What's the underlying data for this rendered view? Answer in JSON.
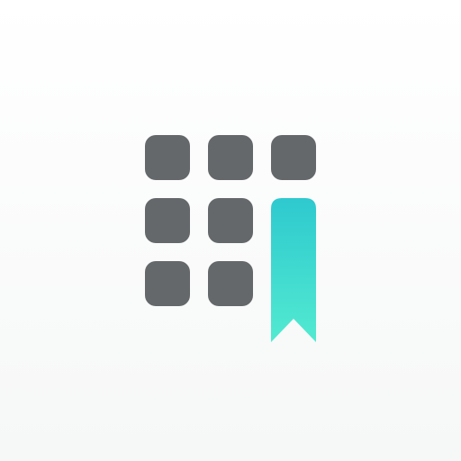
{
  "app_icon": {
    "grid": {
      "rows": 3,
      "cols": 3,
      "tile_color": "#65686b",
      "filled_tiles": [
        [
          true,
          true,
          true
        ],
        [
          true,
          true,
          false
        ],
        [
          true,
          true,
          false
        ]
      ]
    },
    "bookmark": {
      "icon": "bookmark-ribbon-icon",
      "gradient_top": "#2ec9cf",
      "gradient_bottom": "#52ead0"
    },
    "background": {
      "top": "#ffffff",
      "bottom": "#f6f7f7"
    }
  }
}
